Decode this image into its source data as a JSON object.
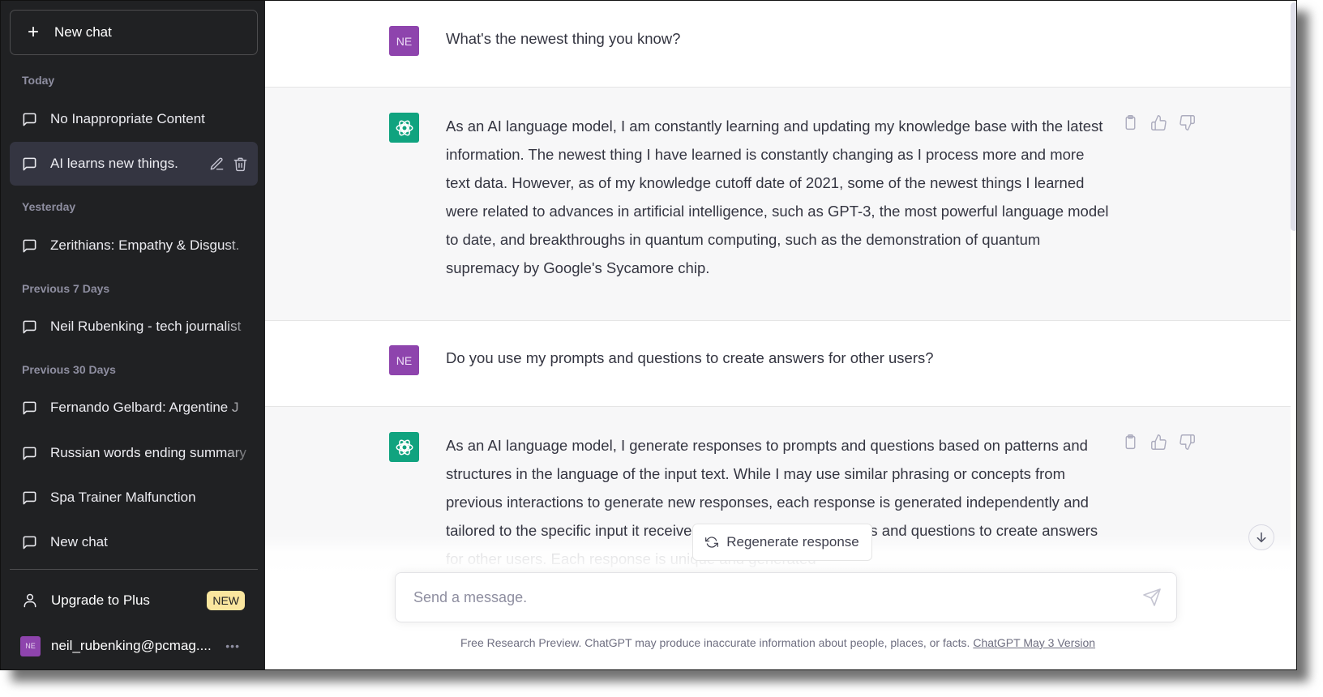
{
  "sidebar": {
    "new_chat_label": "New chat",
    "sections": [
      {
        "label": "Today"
      },
      {
        "label": "Yesterday"
      },
      {
        "label": "Previous 7 Days"
      },
      {
        "label": "Previous 30 Days"
      }
    ],
    "items": [
      {
        "label": "No Inappropriate Content"
      },
      {
        "label": "AI learns new things.",
        "active": true
      },
      {
        "label": "Zerithians: Empathy & Disgust."
      },
      {
        "label": "Neil Rubenking - tech journalist"
      },
      {
        "label": "Fernando Gelbard: Argentine J"
      },
      {
        "label": "Russian words ending summary"
      },
      {
        "label": "Spa Trainer Malfunction"
      },
      {
        "label": "New chat"
      }
    ],
    "upgrade_label": "Upgrade to Plus",
    "upgrade_badge": "NEW",
    "user_initials": "NE",
    "user_email": "neil_rubenking@pcmag....",
    "more_label": "•••"
  },
  "conversation": [
    {
      "role": "user",
      "avatar": "NE",
      "text": "What's the newest thing you know?"
    },
    {
      "role": "assistant",
      "text": "As an AI language model, I am constantly learning and updating my knowledge base with the latest information. The newest thing I have learned is constantly changing as I process more and more text data. However, as of my knowledge cutoff date of 2021, some of the newest things I learned were related to advances in artificial intelligence, such as GPT-3, the most powerful language model to date, and breakthroughs in quantum computing, such as the demonstration of quantum supremacy by Google's Sycamore chip."
    },
    {
      "role": "user",
      "avatar": "NE",
      "text": "Do you use my prompts and questions to create answers for other users?"
    },
    {
      "role": "assistant",
      "text": "As an AI language model, I generate responses to prompts and questions based on patterns and structures in the language of the input text. While I may use similar phrasing or concepts from previous interactions to generate new responses, each response is generated independently and tailored to the specific input it receives. I do not use your prompts and questions to create answers for other users. Each response is unique and generated"
    }
  ],
  "regenerate_label": "Regenerate response",
  "input": {
    "placeholder": "Send a message.",
    "value": ""
  },
  "footer": {
    "text": "Free Research Preview. ChatGPT may produce inaccurate information about people, places, or facts. ",
    "link": "ChatGPT May 3 Version"
  },
  "colors": {
    "sidebar_bg": "#202123",
    "user_avatar": "#8e44ad",
    "assistant_avatar": "#10a37f",
    "badge": "#fae69e"
  }
}
